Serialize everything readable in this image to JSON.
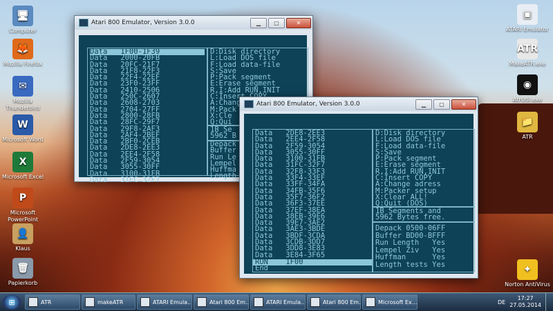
{
  "desktop": {
    "icons_left": [
      {
        "label": "Computer",
        "glyph": "🖥",
        "color": "#5a8ac0"
      },
      {
        "label": "Mozilla Firefox",
        "glyph": "🦊",
        "color": "#e06a1a"
      },
      {
        "label": "Mozilla Thunderbird",
        "glyph": "✉",
        "color": "#3a6ac0"
      },
      {
        "label": "Microsoft Word",
        "glyph": "W",
        "color": "#2a5aa8"
      },
      {
        "label": "Microsoft Excel",
        "glyph": "X",
        "color": "#1f7a3a"
      },
      {
        "label": "Microsoft PowerPoint",
        "glyph": "P",
        "color": "#c04a1a"
      },
      {
        "label": "Klaus",
        "glyph": "👤",
        "color": "#c8a060"
      },
      {
        "label": "Papierkorb",
        "glyph": "🗑",
        "color": "#8a9aaa"
      }
    ],
    "icons_right": [
      {
        "label": "ATARI Emulator",
        "glyph": "▣",
        "color": "#e8eef4"
      },
      {
        "label": "MakeATR.exe",
        "glyph": "ATR",
        "color": "#e8e8e8"
      },
      {
        "label": "AtrUtil.exe",
        "glyph": "◉",
        "color": "#111111"
      },
      {
        "label": "ATR",
        "glyph": "📁",
        "color": "#e0b840"
      },
      {
        "label": "Norton AntiVirus",
        "glyph": "✦",
        "color": "#f0c020"
      }
    ]
  },
  "window_back": {
    "title": "Atari 800 Emulator, Version 3.0.0",
    "left_rows": [
      "Data   1F00-1F39",
      "Data   2000-20FB",
      "Data   20FC-21F7",
      "Data   21F8-22F3",
      "Data   22F4-22EF",
      "Data   23F0-23FF",
      "Data   2410-2506",
      "Data   250C-2607",
      "Data   2608-2703",
      "Data   2704-27FF",
      "Data   2800-28FB",
      "Data   28FC-29F7",
      "Data   29F8-2AF3",
      "Data   2AF4-2BEF",
      "Data   2BF0-2CEB",
      "Data   2DE8-2EE3",
      "Data   2EE4-2F58",
      "Data   2F59-3054",
      "Data   3055-30FF",
      "Data   3100-31FB",
      "Data   31FC-32F7"
    ],
    "menu_rows": [
      "D:Disk directory",
      "L:Load DOS file",
      "F:Load data-file",
      "S:Save",
      "P:Pack segment",
      "E:Erase segment",
      "R,I:Add RUN,INIT",
      "C:Insert COPY",
      "A:Change adress",
      "M:Pack",
      "X:Cle",
      "Q:Qui"
    ],
    "status_rows": [
      "1B Se",
      "5962 B"
    ],
    "option_rows": [
      "Depack",
      "Buffer",
      "Run Le",
      "Lempel",
      "Huffma",
      "Length"
    ]
  },
  "window_front": {
    "title": "Atari 800 Emulator, Version 3.0.0",
    "left_rows": [
      "Data   2DE8-2EE3",
      "Data   2EE4-2F58",
      "Data   2F59-3054",
      "Data   3055-30FF",
      "Data   3100-31FB",
      "Data   31FC-32F7",
      "Data   32F8-33F3",
      "Data   33F4-33EF",
      "Data   33FF-34FA",
      "Data   34FB-35F6",
      "Data   35F7-36F2",
      "Data   36F3-37EE",
      "Data   37EF-38EA",
      "Data   38EB-39E6",
      "Data   39E7-3AE2",
      "Data   3AE3-3BDE",
      "Data   3BDF-3CDA",
      "Data   3CDB-3DD7",
      "Data   3DD8-3E83",
      "Data   3E84-3F65"
    ],
    "selected_row": "RUN    1F00",
    "last_row": "End",
    "menu_rows": [
      "D:Disk directory",
      "L:Load DOS file",
      "F:Load data-file",
      "S:Save",
      "P:Pack segment",
      "E:Erase segment",
      "R,I:Add RUN,INIT",
      "C:Insert COPY",
      "A:Change adress",
      "M:Packer setup",
      "X:Clear ALL!",
      "Q:Quit (DOS)"
    ],
    "status_rows": [
      "1B Segments and",
      "5962 Bytes free."
    ],
    "option_rows": [
      "Depack 0500-06FF",
      "Buffer BD00-BFFF",
      "Run Length   Yes",
      "Lempel Ziv   Yes",
      "Huffman      Yes",
      "Length tests Yes"
    ]
  },
  "controls": {
    "minimize": "▁",
    "maximize": "▢",
    "close": "✕"
  },
  "taskbar": {
    "start_glyph": "⊞",
    "tasks": [
      {
        "label": "ATR",
        "width": 80
      },
      {
        "label": "makeATR",
        "width": 78
      },
      {
        "label": "ATARI Emula...",
        "width": 80
      },
      {
        "label": "Atari 800 Em...",
        "width": 80
      },
      {
        "label": "ATARI Emula...",
        "width": 80
      },
      {
        "label": "Atari 800 Em...",
        "width": 78
      },
      {
        "label": "Microsoft Ex...",
        "width": 80
      }
    ],
    "language": "DE",
    "time": "17:27",
    "date": "27.05.2014"
  }
}
